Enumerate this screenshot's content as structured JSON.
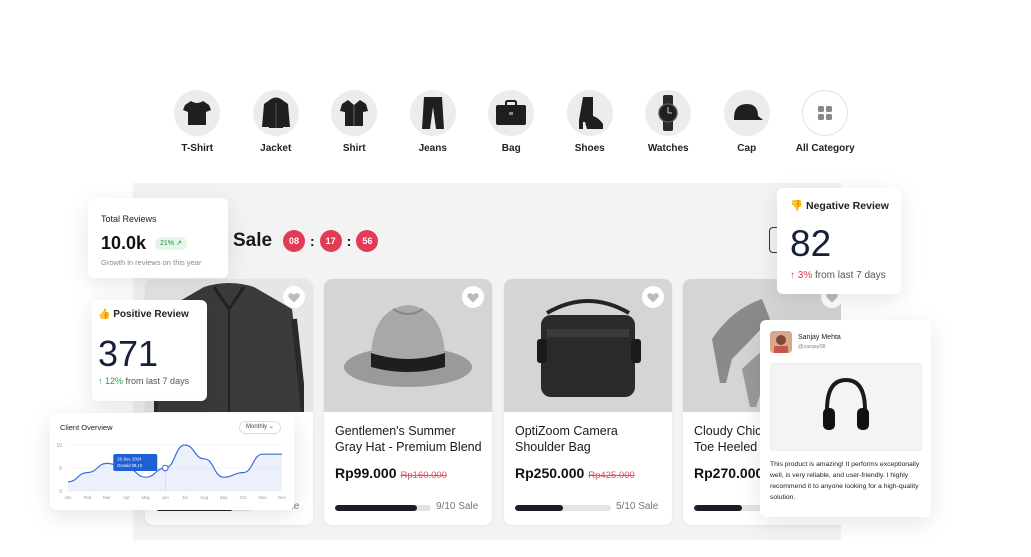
{
  "categories": [
    {
      "label": "T-Shirt",
      "icon": "tshirt-icon"
    },
    {
      "label": "Jacket",
      "icon": "jacket-icon"
    },
    {
      "label": "Shirt",
      "icon": "shirt-icon"
    },
    {
      "label": "Jeans",
      "icon": "jeans-icon"
    },
    {
      "label": "Bag",
      "icon": "bag-icon"
    },
    {
      "label": "Shoes",
      "icon": "shoes-icon"
    },
    {
      "label": "Watches",
      "icon": "watch-icon"
    },
    {
      "label": "Cap",
      "icon": "cap-icon"
    },
    {
      "label": "All Category",
      "icon": "grid-icon"
    }
  ],
  "flash_sale": {
    "title": "Sale",
    "timer": {
      "hours": "08",
      "minutes": "17",
      "seconds": "56"
    },
    "products": [
      {
        "name": "",
        "price": "",
        "old_price": "",
        "sold": "0/10 Sale",
        "progress": 0.8
      },
      {
        "name": "Gentlemen's Summer Gray Hat - Premium Blend",
        "price": "Rp99.000",
        "old_price": "Rp160.000",
        "sold": "9/10 Sale",
        "progress": 0.85
      },
      {
        "name": "OptiZoom Camera Shoulder Bag",
        "price": "Rp250.000",
        "old_price": "Rp425.000",
        "sold": "5/10 Sale",
        "progress": 0.5
      },
      {
        "name": "Cloudy Chic Toe Heeled",
        "price": "Rp270.000",
        "old_price": "",
        "sold": "",
        "progress": 0.5
      }
    ]
  },
  "total_reviews": {
    "title": "Total Reviews",
    "value": "10.0k",
    "change": "21%",
    "subtitle": "Growth in reviews on this year"
  },
  "positive_review": {
    "title": "Positive Review",
    "value": "371",
    "change": "12%",
    "subtitle": "from last 7 days"
  },
  "negative_review": {
    "title": "Negative Review",
    "value": "82",
    "change": "3%",
    "subtitle": "from last 7 days"
  },
  "client_overview": {
    "title": "Client Overview",
    "period": "Monthly",
    "tooltip_date": "26 Jun, 2024",
    "tooltip_label": "Donald",
    "tooltip_value": "09,10"
  },
  "chart_data": {
    "type": "line",
    "x": [
      "Jan",
      "Feb",
      "Mar",
      "Apr",
      "May",
      "Jun",
      "Jul",
      "Aug",
      "Sep",
      "Oct",
      "Nov",
      "Dec"
    ],
    "series": [
      {
        "values": [
          2,
          4,
          6,
          5,
          3,
          5,
          10,
          7,
          3,
          4,
          8,
          8
        ]
      }
    ],
    "y_ticks": [
      "0",
      "5",
      "10"
    ],
    "ylim": [
      0,
      10
    ],
    "color": "#3a6fd8"
  },
  "review_card": {
    "name": "Sanjay Mehta",
    "handle": "@sanjay08",
    "text": "This product is amazing! It performs exceptionally well, is very reliable, and user-friendly. I highly recommend it to anyone looking for a high-quality solution."
  },
  "colors": {
    "accent": "#e23b57",
    "navy": "#17203a",
    "green": "#2a9d48"
  }
}
